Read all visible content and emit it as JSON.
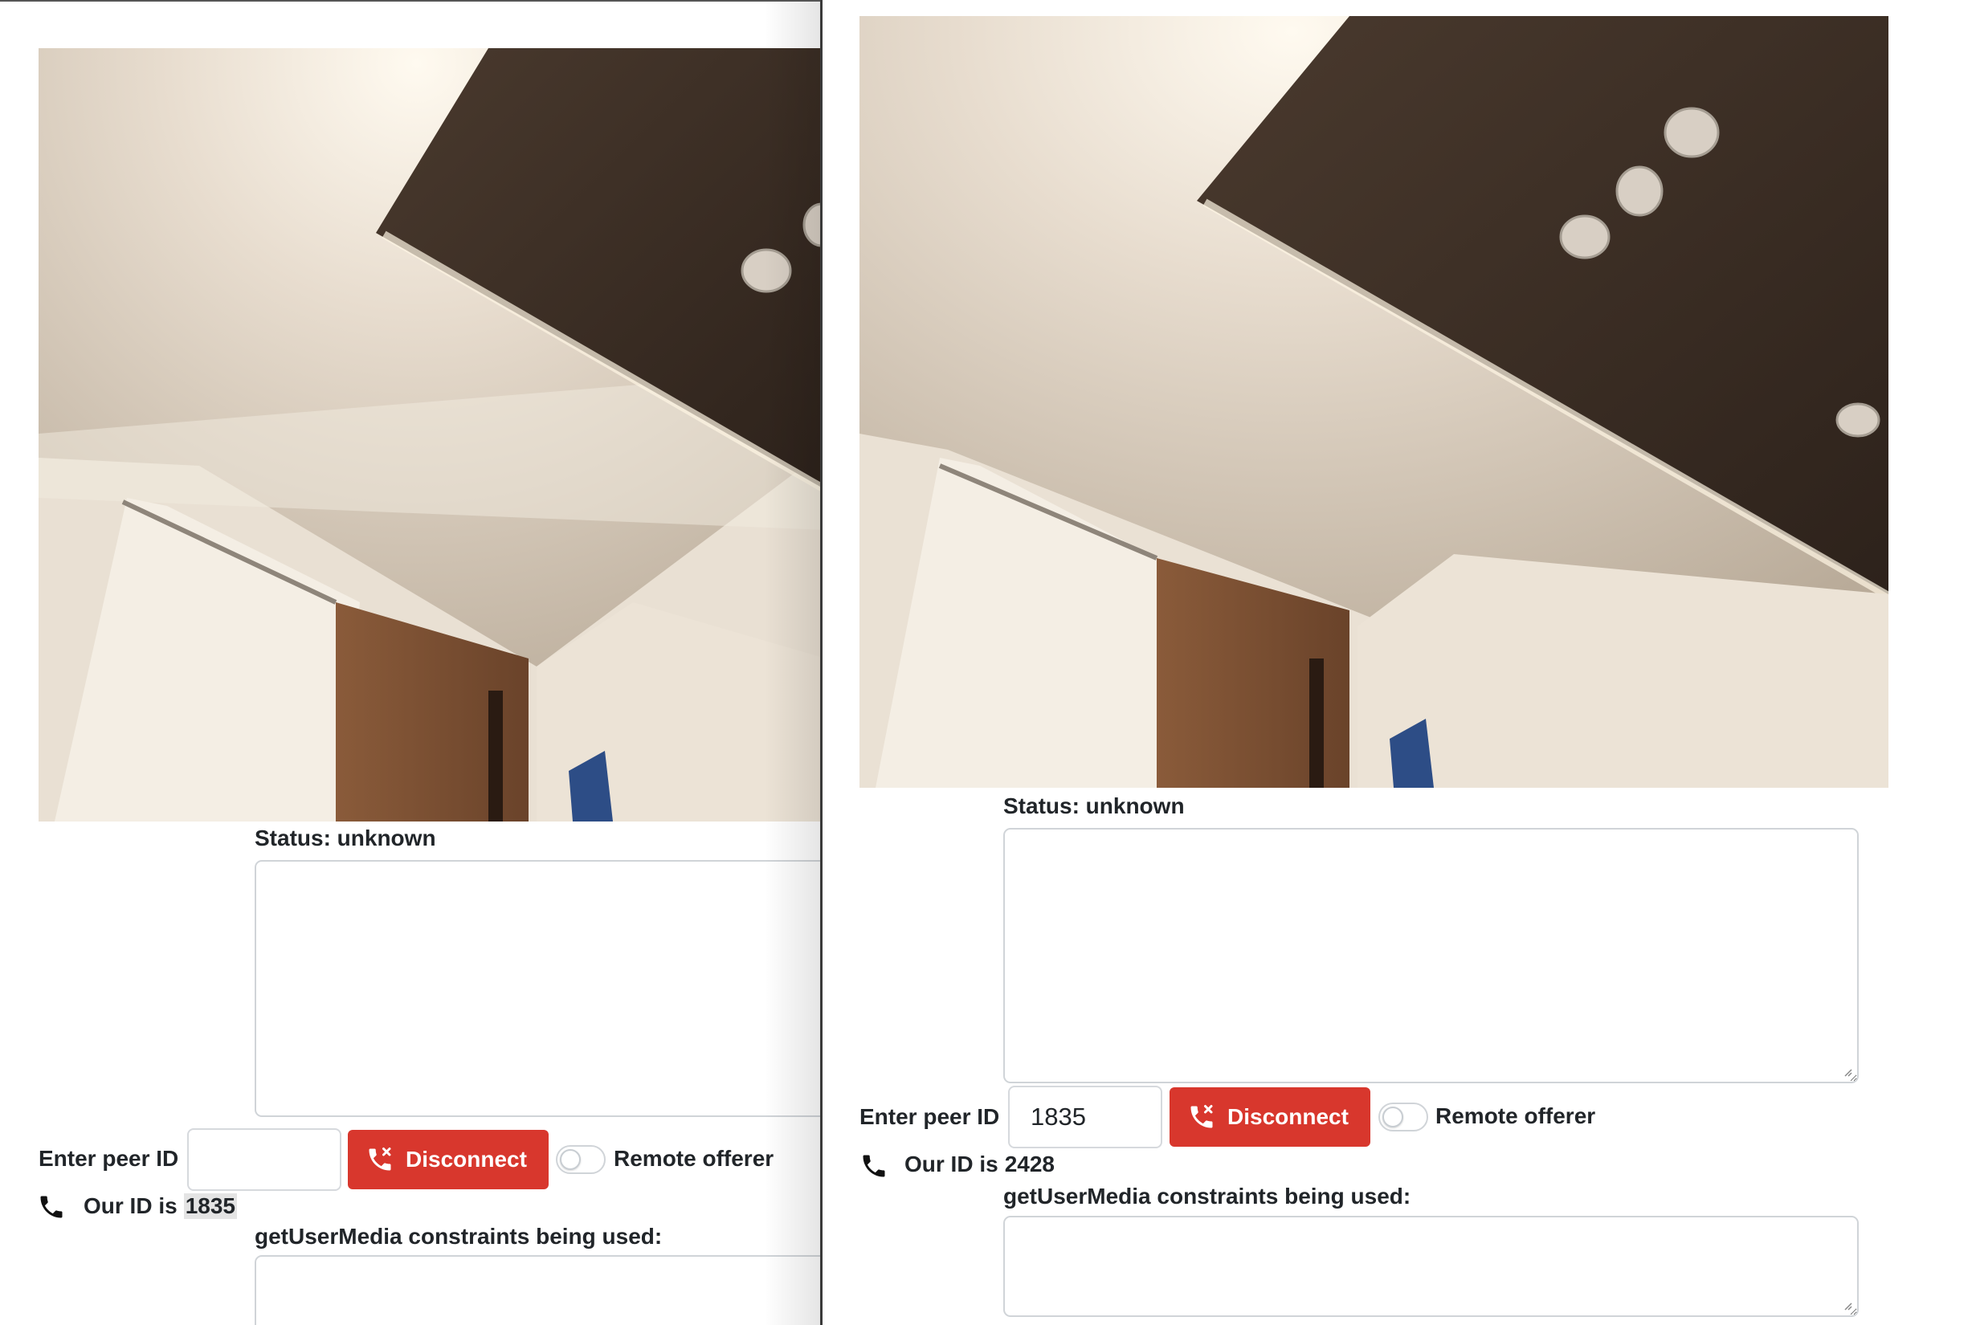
{
  "left": {
    "status_label": "Status: unknown",
    "peer_label": "Enter peer ID",
    "peer_value": "",
    "disconnect_label": "Disconnect",
    "toggle_label": "Remote offerer",
    "our_id_prefix": "Our ID is",
    "our_id": "1835",
    "constraints_label": "getUserMedia constraints being used:"
  },
  "right": {
    "status_label": "Status: unknown",
    "peer_label": "Enter peer ID",
    "peer_value": "1835",
    "disconnect_label": "Disconnect",
    "toggle_label": "Remote offerer",
    "our_id_prefix": "Our ID is",
    "our_id": "2428",
    "constraints_label": "getUserMedia constraints being used:"
  },
  "colors": {
    "danger": "#d8372d",
    "text": "#212529",
    "border": "#d0d4d8"
  },
  "icons": [
    "phone-missed-icon",
    "phone-icon"
  ]
}
